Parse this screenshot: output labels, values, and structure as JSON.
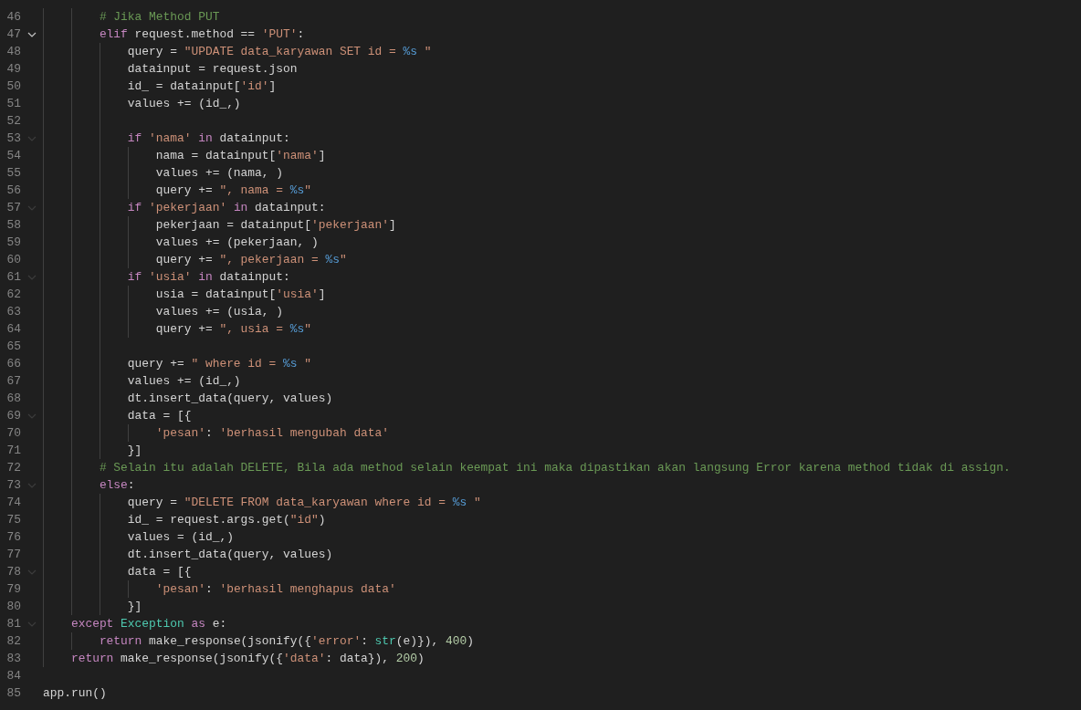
{
  "editor": {
    "lines": [
      {
        "number": "46",
        "foldable": false,
        "tokens": [
          {
            "kind": "comment",
            "text": "        # Jika Method PUT"
          }
        ]
      },
      {
        "number": "47",
        "foldable": true,
        "highlighted": true,
        "tokens": [
          {
            "kind": "keyword",
            "text": "        elif"
          },
          {
            "kind": "plain",
            "text": " request.method == "
          },
          {
            "kind": "string",
            "text": "'PUT'"
          },
          {
            "kind": "plain",
            "text": ":"
          }
        ]
      },
      {
        "number": "48",
        "foldable": false,
        "tokens": [
          {
            "kind": "plain",
            "text": "            query = "
          },
          {
            "kind": "string",
            "text": "\"UPDATE data_karyawan SET id = "
          },
          {
            "kind": "format",
            "text": "%s"
          },
          {
            "kind": "string",
            "text": " \""
          }
        ]
      },
      {
        "number": "49",
        "foldable": false,
        "tokens": [
          {
            "kind": "plain",
            "text": "            datainput = request.json"
          }
        ]
      },
      {
        "number": "50",
        "foldable": false,
        "tokens": [
          {
            "kind": "plain",
            "text": "            id_ = datainput["
          },
          {
            "kind": "string",
            "text": "'id'"
          },
          {
            "kind": "plain",
            "text": "]"
          }
        ]
      },
      {
        "number": "51",
        "foldable": false,
        "tokens": [
          {
            "kind": "plain",
            "text": "            values += (id_,)"
          }
        ]
      },
      {
        "number": "52",
        "foldable": false
      },
      {
        "number": "53",
        "foldable": true,
        "highlighted": false,
        "tokens": [
          {
            "kind": "keyword",
            "text": "            if "
          },
          {
            "kind": "string",
            "text": "'nama' "
          },
          {
            "kind": "keyword",
            "text": "in"
          },
          {
            "kind": "plain",
            "text": " datainput:"
          }
        ]
      },
      {
        "number": "54",
        "foldable": false,
        "tokens": [
          {
            "kind": "plain",
            "text": "                nama = datainput["
          },
          {
            "kind": "string",
            "text": "'nama'"
          },
          {
            "kind": "plain",
            "text": "]"
          }
        ]
      },
      {
        "number": "55",
        "foldable": false,
        "tokens": [
          {
            "kind": "plain",
            "text": "                values += (nama, )"
          }
        ]
      },
      {
        "number": "56",
        "foldable": false,
        "tokens": [
          {
            "kind": "plain",
            "text": "                query += "
          },
          {
            "kind": "string",
            "text": "\", nama = "
          },
          {
            "kind": "format",
            "text": "%s"
          },
          {
            "kind": "string",
            "text": "\""
          }
        ]
      },
      {
        "number": "57",
        "foldable": true,
        "highlighted": false,
        "tokens": [
          {
            "kind": "keyword",
            "text": "            if "
          },
          {
            "kind": "string",
            "text": "'pekerjaan' "
          },
          {
            "kind": "keyword",
            "text": "in"
          },
          {
            "kind": "plain",
            "text": " datainput:"
          }
        ]
      },
      {
        "number": "58",
        "foldable": false,
        "tokens": [
          {
            "kind": "plain",
            "text": "                pekerjaan = datainput["
          },
          {
            "kind": "string",
            "text": "'pekerjaan'"
          },
          {
            "kind": "plain",
            "text": "]"
          }
        ]
      },
      {
        "number": "59",
        "foldable": false,
        "tokens": [
          {
            "kind": "plain",
            "text": "                values += (pekerjaan, )"
          }
        ]
      },
      {
        "number": "60",
        "foldable": false,
        "tokens": [
          {
            "kind": "plain",
            "text": "                query += "
          },
          {
            "kind": "string",
            "text": "\", pekerjaan = "
          },
          {
            "kind": "format",
            "text": "%s"
          },
          {
            "kind": "string",
            "text": "\""
          }
        ]
      },
      {
        "number": "61",
        "foldable": true,
        "highlighted": false,
        "tokens": [
          {
            "kind": "keyword",
            "text": "            if "
          },
          {
            "kind": "string",
            "text": "'usia' "
          },
          {
            "kind": "keyword",
            "text": "in"
          },
          {
            "kind": "plain",
            "text": " datainput:"
          }
        ]
      },
      {
        "number": "62",
        "foldable": false,
        "tokens": [
          {
            "kind": "plain",
            "text": "                usia = datainput["
          },
          {
            "kind": "string",
            "text": "'usia'"
          },
          {
            "kind": "plain",
            "text": "]"
          }
        ]
      },
      {
        "number": "63",
        "foldable": false,
        "tokens": [
          {
            "kind": "plain",
            "text": "                values += (usia, )"
          }
        ]
      },
      {
        "number": "64",
        "foldable": false,
        "tokens": [
          {
            "kind": "plain",
            "text": "                query += "
          },
          {
            "kind": "string",
            "text": "\", usia = "
          },
          {
            "kind": "format",
            "text": "%s"
          },
          {
            "kind": "string",
            "text": "\""
          }
        ]
      },
      {
        "number": "65",
        "foldable": false
      },
      {
        "number": "66",
        "foldable": false,
        "tokens": [
          {
            "kind": "plain",
            "text": "            query += "
          },
          {
            "kind": "string",
            "text": "\" where id = "
          },
          {
            "kind": "format",
            "text": "%s"
          },
          {
            "kind": "string",
            "text": " \""
          }
        ]
      },
      {
        "number": "67",
        "foldable": false,
        "tokens": [
          {
            "kind": "plain",
            "text": "            values += (id_,)"
          }
        ]
      },
      {
        "number": "68",
        "foldable": false,
        "tokens": [
          {
            "kind": "plain",
            "text": "            dt.insert_data(query, values)"
          }
        ]
      },
      {
        "number": "69",
        "foldable": true,
        "highlighted": false,
        "tokens": [
          {
            "kind": "plain",
            "text": "            data = [{"
          }
        ]
      },
      {
        "number": "70",
        "foldable": false,
        "tokens": [
          {
            "kind": "string",
            "text": "                'pesan'"
          },
          {
            "kind": "plain",
            "text": ": "
          },
          {
            "kind": "string",
            "text": "'berhasil mengubah data'"
          }
        ]
      },
      {
        "number": "71",
        "foldable": false,
        "tokens": [
          {
            "kind": "plain",
            "text": "            }]"
          }
        ]
      },
      {
        "number": "72",
        "foldable": false,
        "tokens": [
          {
            "kind": "comment",
            "text": "        # Selain itu adalah DELETE, Bila ada method selain keempat ini maka dipastikan akan langsung Error karena method tidak di assign."
          }
        ]
      },
      {
        "number": "73",
        "foldable": true,
        "highlighted": false,
        "tokens": [
          {
            "kind": "keyword",
            "text": "        else"
          },
          {
            "kind": "plain",
            "text": ":"
          }
        ]
      },
      {
        "number": "74",
        "foldable": false,
        "tokens": [
          {
            "kind": "plain",
            "text": "            query = "
          },
          {
            "kind": "string",
            "text": "\"DELETE FROM data_karyawan where id = "
          },
          {
            "kind": "format",
            "text": "%s"
          },
          {
            "kind": "string",
            "text": " \""
          }
        ]
      },
      {
        "number": "75",
        "foldable": false,
        "tokens": [
          {
            "kind": "plain",
            "text": "            id_ = request.args.get("
          },
          {
            "kind": "string",
            "text": "\"id\""
          },
          {
            "kind": "plain",
            "text": ")"
          }
        ]
      },
      {
        "number": "76",
        "foldable": false,
        "tokens": [
          {
            "kind": "plain",
            "text": "            values = (id_,)"
          }
        ]
      },
      {
        "number": "77",
        "foldable": false,
        "tokens": [
          {
            "kind": "plain",
            "text": "            dt.insert_data(query, values)"
          }
        ]
      },
      {
        "number": "78",
        "foldable": true,
        "highlighted": false,
        "tokens": [
          {
            "kind": "plain",
            "text": "            data = [{"
          }
        ]
      },
      {
        "number": "79",
        "foldable": false,
        "tokens": [
          {
            "kind": "string",
            "text": "                'pesan'"
          },
          {
            "kind": "plain",
            "text": ": "
          },
          {
            "kind": "string",
            "text": "'berhasil menghapus data'"
          }
        ]
      },
      {
        "number": "80",
        "foldable": false,
        "tokens": [
          {
            "kind": "plain",
            "text": "            }]"
          }
        ]
      },
      {
        "number": "81",
        "foldable": true,
        "highlighted": false,
        "tokens": [
          {
            "kind": "keyword",
            "text": "    except"
          },
          {
            "kind": "class",
            "text": " Exception"
          },
          {
            "kind": "keyword",
            "text": " as"
          },
          {
            "kind": "plain",
            "text": " e:"
          }
        ]
      },
      {
        "number": "82",
        "foldable": false,
        "tokens": [
          {
            "kind": "keyword",
            "text": "        return"
          },
          {
            "kind": "plain",
            "text": " make_response(jsonify({"
          },
          {
            "kind": "string",
            "text": "'error'"
          },
          {
            "kind": "plain",
            "text": ": "
          },
          {
            "kind": "class",
            "text": "str"
          },
          {
            "kind": "plain",
            "text": "(e)}), "
          },
          {
            "kind": "number",
            "text": "400"
          },
          {
            "kind": "plain",
            "text": ")"
          }
        ]
      },
      {
        "number": "83",
        "foldable": false,
        "tokens": [
          {
            "kind": "keyword",
            "text": "    return"
          },
          {
            "kind": "plain",
            "text": " make_response(jsonify({"
          },
          {
            "kind": "string",
            "text": "'data'"
          },
          {
            "kind": "plain",
            "text": ": data}), "
          },
          {
            "kind": "number",
            "text": "200"
          },
          {
            "kind": "plain",
            "text": ")"
          }
        ]
      },
      {
        "number": "84",
        "foldable": false
      },
      {
        "number": "85",
        "foldable": false,
        "tokens": [
          {
            "kind": "plain",
            "text": "app.run()"
          }
        ]
      }
    ]
  }
}
